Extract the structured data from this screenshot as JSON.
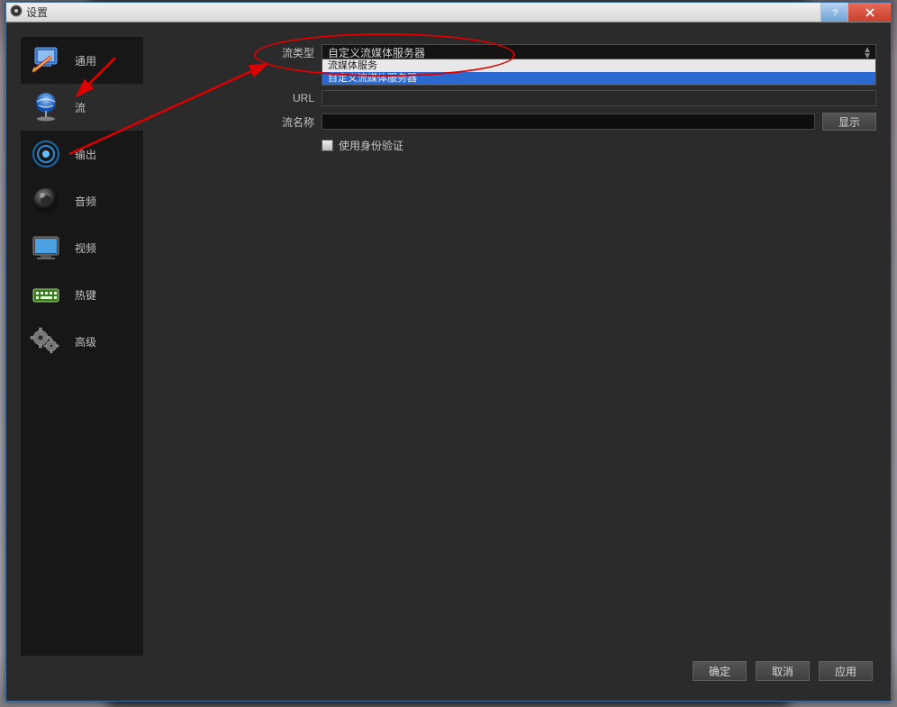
{
  "window": {
    "title": "设置",
    "buttons": {
      "help": "?",
      "close": "X"
    }
  },
  "sidebar": {
    "items": [
      {
        "label": "通用"
      },
      {
        "label": "流"
      },
      {
        "label": "输出"
      },
      {
        "label": "音频"
      },
      {
        "label": "视频"
      },
      {
        "label": "热键"
      },
      {
        "label": "高级"
      }
    ]
  },
  "form": {
    "stream_type_label": "流类型",
    "stream_type_value": "自定义流媒体服务器",
    "stream_type_options": [
      "流媒体服务",
      "自定义流媒体服务器"
    ],
    "url_label": "URL",
    "url_value": "",
    "stream_key_label": "流名称",
    "stream_key_value": "",
    "show_button": "显示",
    "use_auth_label": "使用身份验证",
    "use_auth_checked": false
  },
  "footer": {
    "ok": "确定",
    "cancel": "取消",
    "apply": "应用"
  }
}
